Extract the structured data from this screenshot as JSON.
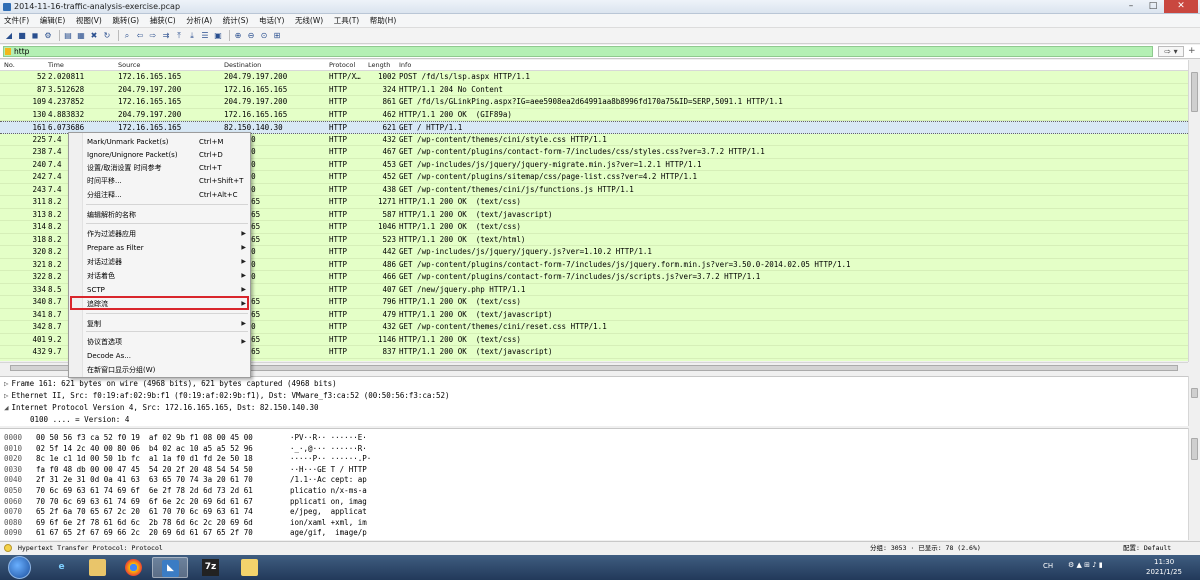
{
  "window": {
    "title": "2014-11-16-traffic-analysis-exercise.pcap"
  },
  "menubar": [
    "文件(F)",
    "编辑(E)",
    "视图(V)",
    "跳转(G)",
    "捕获(C)",
    "分析(A)",
    "统计(S)",
    "电话(Y)",
    "无线(W)",
    "工具(T)",
    "帮助(H)"
  ],
  "filter": {
    "value": "http"
  },
  "columns": {
    "no": "No.",
    "time": "Time",
    "source": "Source",
    "destination": "Destination",
    "protocol": "Protocol",
    "length": "Length",
    "info": "Info"
  },
  "packets": [
    {
      "no": "52",
      "time": "2.020811",
      "src": "172.16.165.165",
      "dst": "204.79.197.200",
      "proto": "HTTP/X…",
      "len": "1002",
      "info": "POST /fd/ls/lsp.aspx HTTP/1.1"
    },
    {
      "no": "87",
      "time": "3.512628",
      "src": "204.79.197.200",
      "dst": "172.16.165.165",
      "proto": "HTTP",
      "len": "324",
      "info": "HTTP/1.1 204 No Content"
    },
    {
      "no": "109",
      "time": "4.237852",
      "src": "172.16.165.165",
      "dst": "204.79.197.200",
      "proto": "HTTP",
      "len": "861",
      "info": "GET /fd/ls/GLinkPing.aspx?IG=aee5908ea2d64991aa8b8996fd170a75&ID=SERP,5091.1 HTTP/1.1"
    },
    {
      "no": "130",
      "time": "4.883832",
      "src": "204.79.197.200",
      "dst": "172.16.165.165",
      "proto": "HTTP",
      "len": "462",
      "info": "HTTP/1.1 200 OK  (GIF89a)"
    },
    {
      "no": "161",
      "time": "6.073686",
      "src": "172.16.165.165",
      "dst": "82.150.140.30",
      "proto": "HTTP",
      "len": "621",
      "info": "GET / HTTP/1.1"
    },
    {
      "no": "225",
      "time": "7.4",
      "src": "",
      "dst": ".140.30",
      "proto": "HTTP",
      "len": "432",
      "info": "GET /wp-content/themes/cini/style.css HTTP/1.1"
    },
    {
      "no": "238",
      "time": "7.4",
      "src": "",
      "dst": ".140.30",
      "proto": "HTTP",
      "len": "467",
      "info": "GET /wp-content/plugins/contact-form-7/includes/css/styles.css?ver=3.7.2 HTTP/1.1"
    },
    {
      "no": "240",
      "time": "7.4",
      "src": "",
      "dst": ".140.30",
      "proto": "HTTP",
      "len": "453",
      "info": "GET /wp-includes/js/jquery/jquery-migrate.min.js?ver=1.2.1 HTTP/1.1"
    },
    {
      "no": "242",
      "time": "7.4",
      "src": "",
      "dst": ".140.30",
      "proto": "HTTP",
      "len": "452",
      "info": "GET /wp-content/plugins/sitemap/css/page-list.css?ver=4.2 HTTP/1.1"
    },
    {
      "no": "243",
      "time": "7.4",
      "src": "",
      "dst": ".140.30",
      "proto": "HTTP",
      "len": "438",
      "info": "GET /wp-content/themes/cini/js/functions.js HTTP/1.1"
    },
    {
      "no": "311",
      "time": "8.2",
      "src": "",
      "dst": ".165.165",
      "proto": "HTTP",
      "len": "1271",
      "info": "HTTP/1.1 200 OK  (text/css)"
    },
    {
      "no": "313",
      "time": "8.2",
      "src": "",
      "dst": ".165.165",
      "proto": "HTTP",
      "len": "587",
      "info": "HTTP/1.1 200 OK  (text/javascript)"
    },
    {
      "no": "314",
      "time": "8.2",
      "src": "",
      "dst": ".165.165",
      "proto": "HTTP",
      "len": "1046",
      "info": "HTTP/1.1 200 OK  (text/css)"
    },
    {
      "no": "318",
      "time": "8.2",
      "src": "",
      "dst": ".165.165",
      "proto": "HTTP",
      "len": "523",
      "info": "HTTP/1.1 200 OK  (text/html)"
    },
    {
      "no": "320",
      "time": "8.2",
      "src": "",
      "dst": ".140.30",
      "proto": "HTTP",
      "len": "442",
      "info": "GET /wp-includes/js/jquery/jquery.js?ver=1.10.2 HTTP/1.1"
    },
    {
      "no": "321",
      "time": "8.2",
      "src": "",
      "dst": ".140.30",
      "proto": "HTTP",
      "len": "486",
      "info": "GET /wp-content/plugins/contact-form-7/includes/js/jquery.form.min.js?ver=3.50.0-2014.02.05 HTTP/1.1"
    },
    {
      "no": "322",
      "time": "8.2",
      "src": "",
      "dst": ".140.30",
      "proto": "HTTP",
      "len": "466",
      "info": "GET /wp-content/plugins/contact-form-7/includes/js/scripts.js?ver=3.7.2 HTTP/1.1"
    },
    {
      "no": "334",
      "time": "8.5",
      "src": "",
      "dst": ".178.9",
      "proto": "HTTP",
      "len": "407",
      "info": "GET /new/jquery.php HTTP/1.1"
    },
    {
      "no": "340",
      "time": "8.7",
      "src": "",
      "dst": ".165.165",
      "proto": "HTTP",
      "len": "796",
      "info": "HTTP/1.1 200 OK  (text/css)"
    },
    {
      "no": "341",
      "time": "8.7",
      "src": "",
      "dst": ".165.165",
      "proto": "HTTP",
      "len": "479",
      "info": "HTTP/1.1 200 OK  (text/javascript)"
    },
    {
      "no": "342",
      "time": "8.7",
      "src": "",
      "dst": ".140.30",
      "proto": "HTTP",
      "len": "432",
      "info": "GET /wp-content/themes/cini/reset.css HTTP/1.1"
    },
    {
      "no": "401",
      "time": "9.2",
      "src": "",
      "dst": ".165.165",
      "proto": "HTTP",
      "len": "1146",
      "info": "HTTP/1.1 200 OK  (text/css)"
    },
    {
      "no": "432",
      "time": "9.7",
      "src": "",
      "dst": ".165.165",
      "proto": "HTTP",
      "len": "837",
      "info": "HTTP/1.1 200 OK  (text/javascript)"
    }
  ],
  "details": [
    "Frame 161: 621 bytes on wire (4968 bits), 621 bytes captured (4968 bits)",
    "Ethernet II, Src: f0:19:af:02:9b:f1 (f0:19:af:02:9b:f1), Dst: VMware_f3:ca:52 (00:50:56:f3:ca:52)",
    "Internet Protocol Version 4, Src: 172.16.165.165, Dst: 82.150.140.30",
    "0100 .... = Version: 4"
  ],
  "hex": [
    {
      "off": "0000",
      "bytes": "00 50 56 f3 ca 52 f0 19  af 02 9b f1 08 00 45 00",
      "ascii": "·PV··R·· ······E·"
    },
    {
      "off": "0010",
      "bytes": "02 5f 14 2c 40 00 80 06  b4 02 ac 10 a5 a5 52 96",
      "ascii": "·_·,@··· ······R·"
    },
    {
      "off": "0020",
      "bytes": "8c 1e c1 1d 00 50 1b fc  a1 1a f0 d1 fd 2e 50 18",
      "ascii": "·····P·· ······.P·"
    },
    {
      "off": "0030",
      "bytes": "fa f0 48 db 00 00 47 45  54 20 2f 20 48 54 54 50",
      "ascii": "··H···GE T / HTTP"
    },
    {
      "off": "0040",
      "bytes": "2f 31 2e 31 0d 0a 41 63  63 65 70 74 3a 20 61 70",
      "ascii": "/1.1··Ac cept: ap"
    },
    {
      "off": "0050",
      "bytes": "70 6c 69 63 61 74 69 6f  6e 2f 78 2d 6d 73 2d 61",
      "ascii": "plicatio n/x-ms-a"
    },
    {
      "off": "0060",
      "bytes": "70 70 6c 69 63 61 74 69  6f 6e 2c 20 69 6d 61 67",
      "ascii": "pplicati on, imag"
    },
    {
      "off": "0070",
      "bytes": "65 2f 6a 70 65 67 2c 20  61 70 70 6c 69 63 61 74",
      "ascii": "e/jpeg,  applicat"
    },
    {
      "off": "0080",
      "bytes": "69 6f 6e 2f 78 61 6d 6c  2b 78 6d 6c 2c 20 69 6d",
      "ascii": "ion/xaml +xml, im"
    },
    {
      "off": "0090",
      "bytes": "61 67 65 2f 67 69 66 2c  20 69 6d 61 67 65 2f 70",
      "ascii": "age/gif,  image/p"
    }
  ],
  "context_menu": [
    {
      "label": "Mark/Unmark Packet(s)",
      "shortcut": "Ctrl+M"
    },
    {
      "label": "Ignore/Unignore Packet(s)",
      "shortcut": "Ctrl+D"
    },
    {
      "label": "设置/取消设置 时间参考",
      "shortcut": "Ctrl+T"
    },
    {
      "label": "时间平移...",
      "shortcut": "Ctrl+Shift+T"
    },
    {
      "label": "分组注释...",
      "shortcut": "Ctrl+Alt+C"
    },
    {
      "label": "编辑解析的名称",
      "shortcut": ""
    },
    {
      "label": "作为过滤器应用",
      "shortcut": "",
      "sub": true
    },
    {
      "label": "Prepare as Filter",
      "shortcut": "",
      "sub": true
    },
    {
      "label": "对话过滤器",
      "shortcut": "",
      "sub": true
    },
    {
      "label": "对话着色",
      "shortcut": "",
      "sub": true
    },
    {
      "label": "SCTP",
      "shortcut": "",
      "sub": true
    },
    {
      "label": "追踪流",
      "shortcut": "",
      "sub": true
    },
    {
      "label": "复制",
      "shortcut": "",
      "sub": true
    },
    {
      "label": "协议首选项",
      "shortcut": "",
      "sub": true
    },
    {
      "label": "Decode As...",
      "shortcut": ""
    },
    {
      "label": "在新窗口显示分组(W)",
      "shortcut": ""
    }
  ],
  "status": {
    "left": "Hypertext Transfer Protocol: Protocol",
    "packets": "分组: 3053 · 已显示: 78 (2.6%)",
    "profile": "配置: Default"
  },
  "tray": {
    "time": "11:30",
    "date": "2021/1/25",
    "lang": "CH"
  },
  "colors": {
    "http_row": "#e4ffc7",
    "selected": "#d8e8f5",
    "filter_ok": "#b4f0b4",
    "highlight": "#d9262c"
  }
}
